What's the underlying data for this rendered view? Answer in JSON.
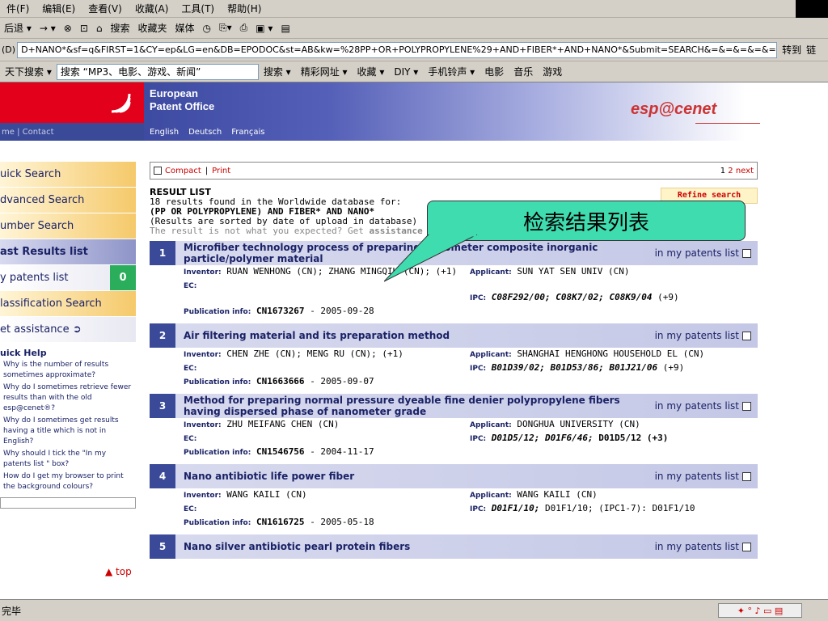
{
  "browser": {
    "menu": [
      "件(F)",
      "编辑(E)",
      "查看(V)",
      "收藏(A)",
      "工具(T)",
      "帮助(H)"
    ],
    "toolbar": [
      "后退 ▾",
      "→ ▾",
      "⊗",
      "⊡",
      "⌂",
      "搜索",
      "收藏夹",
      "媒体",
      "◷",
      "⎘▾",
      "⎙",
      "▣ ▾",
      "▤"
    ],
    "address_prefix": "(D)",
    "address": "D+NANO*&sf=q&FIRST=1&CY=ep&LG=en&DB=EPODOC&st=AB&kw=%28PP+OR+POLYPROPYLENE%29+AND+FIBER*+AND+NANO*&Submit=SEARCH&=&=&=&=&=&=&=",
    "go_label": "转到",
    "links_label": "链",
    "search_label": "天下搜索 ▾",
    "search_value": "搜索 “MP3、电影、游戏、新闻”",
    "search_items": [
      "搜索 ▾",
      "精彩网址 ▾",
      "收藏 ▾",
      "DIY ▾",
      "手机铃声 ▾",
      "电影",
      "音乐",
      "游戏"
    ]
  },
  "epo": {
    "title_line1": "European",
    "title_line2": "Patent Office",
    "langs": [
      "English",
      "Deutsch",
      "Français"
    ],
    "subbar": "me | Contact",
    "brand": "esp@cenet"
  },
  "nav": {
    "items": [
      {
        "label": "uick Search",
        "style": "orange"
      },
      {
        "label": "dvanced Search",
        "style": "orange"
      },
      {
        "label": "umber Search",
        "style": "orange"
      },
      {
        "label": "ast Results list",
        "style": "blue"
      },
      {
        "label": "y patents list",
        "style": "light",
        "count": "0"
      },
      {
        "label": "lassification Search",
        "style": "orange"
      },
      {
        "label": "et assistance ➲",
        "style": "light"
      }
    ],
    "quick_help_title": "uick Help",
    "quick_help_links": [
      "Why is the number of results sometimes approximate?",
      "Why do I sometimes retrieve fewer results than with the old esp@cenet®?",
      "Why do I sometimes get results having a title which is not in English?",
      "Why should I tick the \"In my patents list \" box?",
      "How do I get my browser to print the background colours?"
    ],
    "top_link": "▲ top"
  },
  "main": {
    "compact": "Compact",
    "sep": "|",
    "print": "Print",
    "page_current": "1",
    "page_next": "2",
    "page_next_label": "next",
    "result_list_title": "RESULT LIST",
    "result_count_line": "18 results found in the Worldwide database for:",
    "query": "(PP OR POLYPROPYLENE) AND FIBER* AND NANO*",
    "sorted_line": "(Results are sorted by date of upload in database)",
    "hint": "The result is not what you expected? Get",
    "hint_link": "assistance ➲",
    "refine": "Refine search",
    "in_list_label": "in my patents list",
    "inventor_label": "Inventor:",
    "applicant_label": "Applicant:",
    "ec_label": "EC:",
    "ipc_label": "IPC:",
    "pub_label": "Publication info:"
  },
  "results": [
    {
      "num": "1",
      "title": "Microfiber technology process of preparing nanometer composite inorganic particle/polymer material",
      "inventor": "RUAN WENHONG (CN); ZHANG MINGQIU (CN); (+1)",
      "applicant": "SUN YAT SEN UNIV (CN)",
      "ipc": "C08F292/00; C08K7/02; C08K9/04",
      "ipc_extra": "(+9)",
      "pub_num": "CN1673267",
      "pub_date": "- 2005-09-28"
    },
    {
      "num": "2",
      "title": "Air filtering material and its preparation method",
      "inventor": "CHEN ZHE (CN); MENG RU (CN); (+1)",
      "applicant": "SHANGHAI HENGHONG HOUSEHOLD EL (CN)",
      "ipc": "B01D39/02; B01D53/86; B01J21/06",
      "ipc_extra": "(+9)",
      "pub_num": "CN1663666",
      "pub_date": "- 2005-09-07"
    },
    {
      "num": "3",
      "title": "Method for preparing normal pressure dyeable fine denier polypropylene fibers having dispersed phase of nanometer grade",
      "inventor": "ZHU MEIFANG CHEN (CN)",
      "applicant": "DONGHUA UNIVERSITY (CN)",
      "ipc": "D01D5/12; D01F6/46;",
      "ipc_extra": "D01D5/12 (+3)",
      "pub_num": "CN1546756",
      "pub_date": "- 2004-11-17"
    },
    {
      "num": "4",
      "title": "Nano antibiotic life power fiber",
      "inventor": "WANG KAILI (CN)",
      "applicant": "WANG KAILI (CN)",
      "ipc": "D01F1/10;",
      "ipc_extra": "D01F1/10; (IPC1-7): D01F1/10",
      "pub_num": "CN1616725",
      "pub_date": "- 2005-05-18"
    },
    {
      "num": "5",
      "title": "Nano silver antibiotic pearl protein fibers"
    }
  ],
  "callout": "检索结果列表",
  "status": "完毕",
  "colors": {
    "epo_red": "#e2001a",
    "nav_blue": "#3a4a98",
    "callout": "#3fdcb0",
    "count_green": "#2bae5b"
  }
}
